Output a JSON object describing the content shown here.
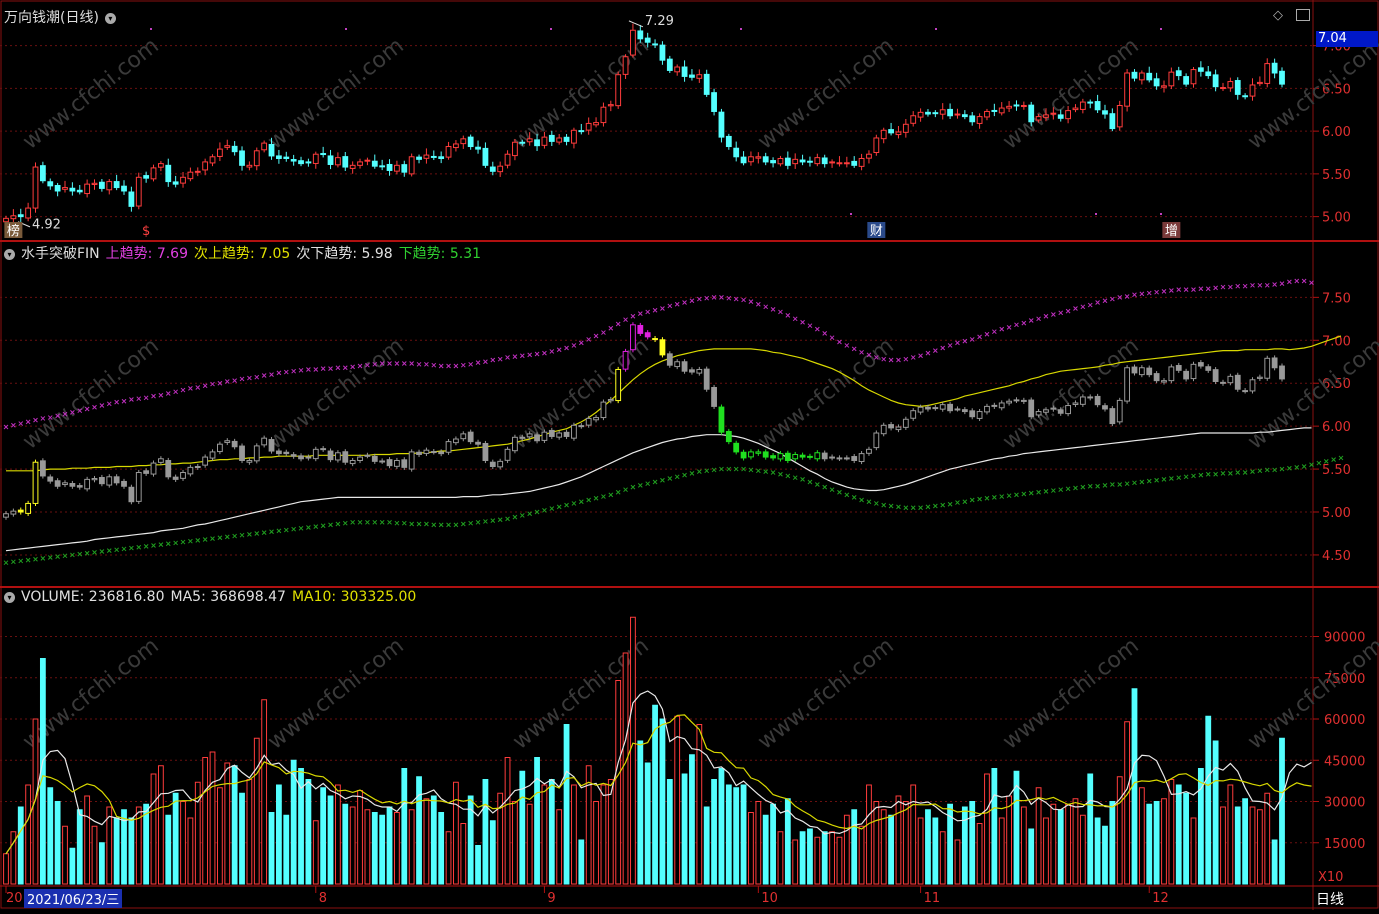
{
  "title": "万向钱潮(日线)",
  "price_box": "7.04",
  "hi_label": "7.29",
  "lo_label": "4.92",
  "events": [
    {
      "text": "榜",
      "color": "#ffffff",
      "bg": "#7a5a3a",
      "day": 1
    },
    {
      "text": "$",
      "color": "#ff4040",
      "bg": "",
      "day": 19
    },
    {
      "text": "财",
      "color": "#ffffff",
      "bg": "#2a4a8a",
      "day": 118
    },
    {
      "text": "增",
      "color": "#ffffff",
      "bg": "#7a3a3a",
      "day": 158
    }
  ],
  "p2": {
    "name": "水手突破FIN",
    "items": [
      {
        "k": "上趋势: 7.69",
        "c": "#e040e0"
      },
      {
        "k": "次上趋势: 7.05",
        "c": "#e0e000"
      },
      {
        "k": "次下趋势: 5.98",
        "c": "#e0e0e0"
      },
      {
        "k": "下趋势: 5.31",
        "c": "#30d030"
      }
    ]
  },
  "p3": {
    "items": [
      {
        "k": "VOLUME: 236816.80",
        "c": "#e0e0e0"
      },
      {
        "k": "MA5: 368698.47",
        "c": "#e0e0e0"
      },
      {
        "k": "MA10: 303325.00",
        "c": "#e0e000"
      }
    ]
  },
  "p1_ticks": [
    "7.00",
    "6.50",
    "6.00",
    "5.50",
    "5.00"
  ],
  "p2_ticks": [
    "7.50",
    "7.00",
    "6.50",
    "6.00",
    "5.50",
    "5.00",
    "4.50"
  ],
  "p3_ticks": [
    "90000",
    "75000",
    "60000",
    "45000",
    "30000",
    "15000"
  ],
  "x_labels": [
    {
      "t": "20",
      "day": 0
    },
    {
      "t": "8",
      "day": 42
    },
    {
      "t": "9",
      "day": 73
    },
    {
      "t": "10",
      "day": 102
    },
    {
      "t": "11",
      "day": 124
    },
    {
      "t": "12",
      "day": 155
    }
  ],
  "date_box": "2021/06/23/三",
  "x10": "X10",
  "period": "日线",
  "watermark": "www.cfchi.com",
  "colors": {
    "up": "#ff3c3c",
    "down": "#54ffff",
    "bg": "#000000",
    "grid": "#6a1010"
  },
  "chart_data": {
    "type": "candlestick",
    "title": "万向钱潮(日线)",
    "x_labels": [
      "20",
      "8",
      "9",
      "10",
      "11",
      "12"
    ],
    "close": [
      4.98,
      5.01,
      5.0,
      5.1,
      5.58,
      5.42,
      5.36,
      5.3,
      5.34,
      5.3,
      5.29,
      5.38,
      5.39,
      5.33,
      5.41,
      5.34,
      5.3,
      5.12,
      5.46,
      5.45,
      5.57,
      5.62,
      5.41,
      5.38,
      5.46,
      5.52,
      5.53,
      5.64,
      5.7,
      5.79,
      5.83,
      5.76,
      5.6,
      5.6,
      5.77,
      5.86,
      5.71,
      5.68,
      5.68,
      5.65,
      5.62,
      5.63,
      5.73,
      5.73,
      5.61,
      5.69,
      5.58,
      5.6,
      5.64,
      5.66,
      5.59,
      5.59,
      5.54,
      5.6,
      5.52,
      5.7,
      5.67,
      5.72,
      5.7,
      5.68,
      5.82,
      5.85,
      5.91,
      5.82,
      5.79,
      5.6,
      5.53,
      5.59,
      5.73,
      5.87,
      5.86,
      5.91,
      5.83,
      5.93,
      5.88,
      5.92,
      5.88,
      6.01,
      6.0,
      6.09,
      6.1,
      6.28,
      6.31,
      6.66,
      6.87,
      7.18,
      7.08,
      7.04,
      7.01,
      6.83,
      6.71,
      6.75,
      6.64,
      6.63,
      6.66,
      6.43,
      6.23,
      5.93,
      5.82,
      5.7,
      5.63,
      5.7,
      5.7,
      5.64,
      5.63,
      5.68,
      5.6,
      5.67,
      5.64,
      5.64,
      5.69,
      5.62,
      5.64,
      5.63,
      5.63,
      5.6,
      5.68,
      5.73,
      5.92,
      6.01,
      5.98,
      5.99,
      6.08,
      6.18,
      6.22,
      6.2,
      6.21,
      6.25,
      6.18,
      6.2,
      6.17,
      6.11,
      6.17,
      6.23,
      6.23,
      6.27,
      6.29,
      6.3,
      6.3,
      6.11,
      6.17,
      6.19,
      6.21,
      6.15,
      6.24,
      6.27,
      6.34,
      6.33,
      6.25,
      6.2,
      6.03,
      6.3,
      6.68,
      6.62,
      6.68,
      6.6,
      6.53,
      6.53,
      6.69,
      6.65,
      6.55,
      6.72,
      6.7,
      6.65,
      6.52,
      6.51,
      6.58,
      6.43,
      6.41,
      6.54,
      6.57,
      6.79,
      6.68,
      6.55
    ],
    "volume": [
      11000,
      19000,
      28000,
      36000,
      60000,
      82000,
      35000,
      30000,
      21000,
      13000,
      27000,
      32000,
      21000,
      15000,
      28000,
      24000,
      27000,
      24000,
      28000,
      29000,
      40000,
      43000,
      25000,
      33000,
      30000,
      24000,
      37000,
      46000,
      48000,
      35000,
      44000,
      43000,
      33000,
      38000,
      53000,
      67000,
      26000,
      36000,
      25000,
      45000,
      42000,
      38000,
      23000,
      35000,
      32000,
      36000,
      29000,
      28000,
      34000,
      27000,
      26000,
      25000,
      28000,
      26000,
      42000,
      27000,
      39000,
      31000,
      32000,
      26000,
      19000,
      37000,
      22000,
      32000,
      14000,
      38000,
      23000,
      33000,
      46000,
      30000,
      41000,
      29000,
      46000,
      36000,
      38000,
      27000,
      58000,
      36000,
      16000,
      43000,
      30000,
      36000,
      38000,
      74000,
      84000,
      97000,
      52000,
      44000,
      65000,
      60000,
      38000,
      61000,
      40000,
      47000,
      58000,
      28000,
      38000,
      42000,
      36000,
      35000,
      36000,
      26000,
      30000,
      25000,
      29000,
      19000,
      31000,
      16000,
      19000,
      20000,
      17000,
      19000,
      19000,
      17000,
      25000,
      27000,
      21000,
      36000,
      30000,
      27000,
      25000,
      32000,
      30000,
      36000,
      24000,
      27000,
      24000,
      19000,
      29000,
      16000,
      28000,
      30000,
      22000,
      40000,
      42000,
      24000,
      32000,
      41000,
      28000,
      20000,
      35000,
      24000,
      29000,
      27000,
      29000,
      31000,
      25000,
      40000,
      24000,
      21000,
      30000,
      39000,
      59000,
      71000,
      35000,
      29000,
      30000,
      31000,
      38000,
      36000,
      33000,
      24000,
      42000,
      61000,
      52000,
      28000,
      36000,
      28000,
      31000,
      28000,
      27000,
      33000,
      16000,
      53000,
      73000,
      43000,
      28000,
      24000
    ],
    "upper_trend": [
      5.99,
      6.01,
      6.03,
      6.05,
      6.07,
      6.09,
      6.1,
      6.12,
      6.14,
      6.16,
      6.18,
      6.2,
      6.22,
      6.24,
      6.26,
      6.28,
      6.29,
      6.31,
      6.32,
      6.33,
      6.35,
      6.36,
      6.38,
      6.4,
      6.42,
      6.44,
      6.45,
      6.47,
      6.49,
      6.5,
      6.52,
      6.53,
      6.55,
      6.56,
      6.57,
      6.59,
      6.6,
      6.62,
      6.63,
      6.64,
      6.65,
      6.66,
      6.66,
      6.67,
      6.67,
      6.68,
      6.68,
      6.69,
      6.7,
      6.71,
      6.72,
      6.73,
      6.73,
      6.73,
      6.73,
      6.73,
      6.72,
      6.72,
      6.71,
      6.7,
      6.7,
      6.7,
      6.71,
      6.72,
      6.74,
      6.75,
      6.77,
      6.78,
      6.8,
      6.81,
      6.82,
      6.83,
      6.84,
      6.85,
      6.87,
      6.89,
      6.91,
      6.94,
      6.97,
      7.01,
      7.05,
      7.09,
      7.14,
      7.19,
      7.24,
      7.28,
      7.31,
      7.33,
      7.35,
      7.37,
      7.4,
      7.42,
      7.44,
      7.46,
      7.48,
      7.49,
      7.5,
      7.5,
      7.49,
      7.48,
      7.47,
      7.45,
      7.42,
      7.39,
      7.36,
      7.33,
      7.29,
      7.25,
      7.21,
      7.17,
      7.13,
      7.08,
      7.03,
      6.98,
      6.94,
      6.9,
      6.86,
      6.83,
      6.8,
      6.78,
      6.77,
      6.77,
      6.78,
      6.8,
      6.82,
      6.85,
      6.88,
      6.91,
      6.94,
      6.97,
      6.99,
      7.01,
      7.04,
      7.07,
      7.1,
      7.13,
      7.15,
      7.18,
      7.2,
      7.23,
      7.25,
      7.28,
      7.3,
      7.32,
      7.34,
      7.37,
      7.39,
      7.41,
      7.44,
      7.46,
      7.48,
      7.5,
      7.51,
      7.53,
      7.54,
      7.55,
      7.56,
      7.57,
      7.58,
      7.59,
      7.59,
      7.59,
      7.6,
      7.6,
      7.61,
      7.62,
      7.62,
      7.63,
      7.63,
      7.64,
      7.64,
      7.64,
      7.65,
      7.66,
      7.68,
      7.69,
      7.69,
      7.67
    ],
    "upper2_trend": [
      5.48,
      5.48,
      5.48,
      5.48,
      5.48,
      5.49,
      5.5,
      5.5,
      5.5,
      5.51,
      5.51,
      5.51,
      5.52,
      5.52,
      5.52,
      5.53,
      5.53,
      5.53,
      5.54,
      5.54,
      5.55,
      5.55,
      5.56,
      5.56,
      5.57,
      5.57,
      5.58,
      5.59,
      5.6,
      5.61,
      5.61,
      5.62,
      5.62,
      5.63,
      5.63,
      5.64,
      5.64,
      5.65,
      5.65,
      5.65,
      5.65,
      5.65,
      5.66,
      5.66,
      5.66,
      5.66,
      5.66,
      5.66,
      5.66,
      5.66,
      5.67,
      5.67,
      5.67,
      5.68,
      5.68,
      5.68,
      5.69,
      5.69,
      5.7,
      5.71,
      5.71,
      5.72,
      5.73,
      5.74,
      5.75,
      5.76,
      5.77,
      5.78,
      5.79,
      5.81,
      5.83,
      5.85,
      5.88,
      5.9,
      5.93,
      5.95,
      5.97,
      6.01,
      6.05,
      6.1,
      6.16,
      6.23,
      6.3,
      6.38,
      6.46,
      6.54,
      6.61,
      6.67,
      6.72,
      6.76,
      6.79,
      6.82,
      6.84,
      6.86,
      6.88,
      6.89,
      6.9,
      6.9,
      6.9,
      6.9,
      6.9,
      6.9,
      6.89,
      6.88,
      6.86,
      6.85,
      6.83,
      6.81,
      6.79,
      6.76,
      6.73,
      6.7,
      6.67,
      6.63,
      6.58,
      6.53,
      6.47,
      6.42,
      6.38,
      6.34,
      6.3,
      6.27,
      6.25,
      6.24,
      6.23,
      6.24,
      6.26,
      6.28,
      6.3,
      6.32,
      6.35,
      6.37,
      6.39,
      6.41,
      6.43,
      6.45,
      6.47,
      6.5,
      6.52,
      6.55,
      6.57,
      6.6,
      6.62,
      6.64,
      6.65,
      6.66,
      6.67,
      6.68,
      6.69,
      6.71,
      6.72,
      6.74,
      6.75,
      6.76,
      6.77,
      6.78,
      6.79,
      6.8,
      6.81,
      6.82,
      6.83,
      6.84,
      6.85,
      6.86,
      6.87,
      6.88,
      6.88,
      6.88,
      6.89,
      6.89,
      6.89,
      6.89,
      6.9,
      6.9,
      6.89,
      6.9,
      6.91,
      6.93,
      6.96,
      6.99,
      7.02,
      7.05
    ],
    "lower2_trend": [
      4.55,
      4.56,
      4.57,
      4.58,
      4.59,
      4.6,
      4.61,
      4.62,
      4.63,
      4.64,
      4.65,
      4.66,
      4.68,
      4.69,
      4.7,
      4.71,
      4.72,
      4.73,
      4.74,
      4.75,
      4.76,
      4.78,
      4.79,
      4.8,
      4.81,
      4.83,
      4.85,
      4.86,
      4.88,
      4.9,
      4.92,
      4.94,
      4.96,
      4.98,
      5.0,
      5.02,
      5.04,
      5.06,
      5.08,
      5.1,
      5.12,
      5.13,
      5.14,
      5.15,
      5.16,
      5.17,
      5.17,
      5.17,
      5.17,
      5.17,
      5.17,
      5.17,
      5.17,
      5.17,
      5.17,
      5.17,
      5.17,
      5.17,
      5.17,
      5.17,
      5.17,
      5.17,
      5.18,
      5.18,
      5.18,
      5.19,
      5.2,
      5.2,
      5.21,
      5.22,
      5.23,
      5.24,
      5.26,
      5.28,
      5.3,
      5.32,
      5.35,
      5.38,
      5.41,
      5.45,
      5.49,
      5.53,
      5.57,
      5.61,
      5.65,
      5.69,
      5.72,
      5.75,
      5.78,
      5.81,
      5.83,
      5.85,
      5.86,
      5.88,
      5.89,
      5.9,
      5.9,
      5.9,
      5.89,
      5.88,
      5.86,
      5.83,
      5.8,
      5.76,
      5.72,
      5.68,
      5.63,
      5.58,
      5.53,
      5.48,
      5.44,
      5.39,
      5.35,
      5.32,
      5.29,
      5.27,
      5.26,
      5.25,
      5.25,
      5.26,
      5.28,
      5.3,
      5.32,
      5.35,
      5.38,
      5.41,
      5.44,
      5.47,
      5.5,
      5.52,
      5.54,
      5.56,
      5.58,
      5.6,
      5.62,
      5.63,
      5.65,
      5.66,
      5.68,
      5.69,
      5.7,
      5.71,
      5.72,
      5.73,
      5.74,
      5.75,
      5.76,
      5.77,
      5.78,
      5.79,
      5.8,
      5.81,
      5.82,
      5.83,
      5.84,
      5.85,
      5.86,
      5.87,
      5.88,
      5.89,
      5.9,
      5.91,
      5.92,
      5.92,
      5.92,
      5.92,
      5.92,
      5.92,
      5.92,
      5.92,
      5.93,
      5.93,
      5.94,
      5.95,
      5.96,
      5.97,
      5.98,
      5.98
    ],
    "lower_trend": [
      4.41,
      4.42,
      4.43,
      4.44,
      4.45,
      4.46,
      4.47,
      4.48,
      4.49,
      4.5,
      4.51,
      4.52,
      4.53,
      4.54,
      4.55,
      4.56,
      4.57,
      4.58,
      4.59,
      4.6,
      4.61,
      4.62,
      4.63,
      4.64,
      4.65,
      4.66,
      4.67,
      4.68,
      4.69,
      4.7,
      4.71,
      4.72,
      4.73,
      4.74,
      4.75,
      4.76,
      4.77,
      4.78,
      4.79,
      4.8,
      4.81,
      4.82,
      4.83,
      4.84,
      4.85,
      4.86,
      4.87,
      4.88,
      4.88,
      4.88,
      4.88,
      4.88,
      4.88,
      4.87,
      4.87,
      4.86,
      4.86,
      4.86,
      4.85,
      4.85,
      4.85,
      4.85,
      4.86,
      4.87,
      4.88,
      4.89,
      4.9,
      4.91,
      4.92,
      4.94,
      4.96,
      4.98,
      5.0,
      5.02,
      5.04,
      5.06,
      5.08,
      5.1,
      5.12,
      5.14,
      5.16,
      5.18,
      5.2,
      5.23,
      5.26,
      5.29,
      5.31,
      5.33,
      5.35,
      5.37,
      5.39,
      5.41,
      5.43,
      5.45,
      5.47,
      5.48,
      5.49,
      5.5,
      5.5,
      5.5,
      5.5,
      5.49,
      5.48,
      5.47,
      5.46,
      5.44,
      5.42,
      5.4,
      5.38,
      5.35,
      5.32,
      5.29,
      5.26,
      5.23,
      5.2,
      5.17,
      5.14,
      5.12,
      5.1,
      5.08,
      5.07,
      5.06,
      5.05,
      5.05,
      5.05,
      5.06,
      5.07,
      5.08,
      5.09,
      5.11,
      5.12,
      5.14,
      5.15,
      5.16,
      5.17,
      5.18,
      5.19,
      5.2,
      5.21,
      5.22,
      5.23,
      5.24,
      5.25,
      5.26,
      5.27,
      5.28,
      5.29,
      5.3,
      5.3,
      5.31,
      5.32,
      5.32,
      5.33,
      5.34,
      5.35,
      5.36,
      5.37,
      5.38,
      5.39,
      5.4,
      5.41,
      5.42,
      5.43,
      5.44,
      5.44,
      5.45,
      5.45,
      5.46,
      5.46,
      5.47,
      5.48,
      5.49,
      5.49,
      5.5,
      5.51,
      5.52,
      5.53,
      5.55,
      5.57,
      5.59,
      5.61,
      5.63
    ],
    "ranges": {
      "price": [
        4.75,
        7.3
      ],
      "trend": [
        4.15,
        7.9
      ],
      "volume": [
        0,
        100000
      ]
    }
  }
}
